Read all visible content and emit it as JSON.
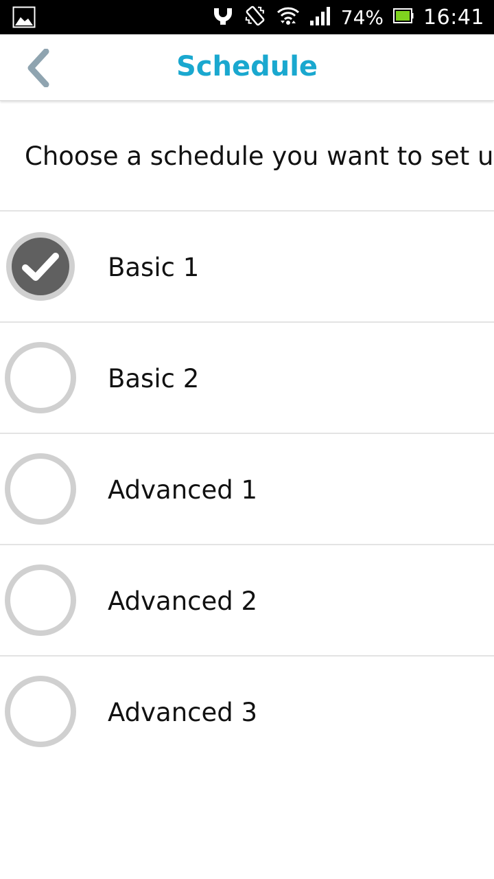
{
  "status_bar": {
    "battery_percent": "74%",
    "time": "16:41",
    "icons": [
      "gallery-notification-icon",
      "usb-icon",
      "vibrate-icon",
      "wifi-icon",
      "signal-icon",
      "battery-icon"
    ]
  },
  "header": {
    "title": "Schedule",
    "back_icon": "chevron-left-icon"
  },
  "prompt": "Choose a schedule you want to set up",
  "options": [
    {
      "label": "Basic 1",
      "selected": true
    },
    {
      "label": "Basic 2",
      "selected": false
    },
    {
      "label": "Advanced 1",
      "selected": false
    },
    {
      "label": "Advanced 2",
      "selected": false
    },
    {
      "label": "Advanced 3",
      "selected": false
    }
  ],
  "colors": {
    "accent": "#1aa8cf",
    "back_arrow": "#8fa4b0",
    "radio_ring": "#d0d0d0",
    "radio_selected_fill": "#606060"
  }
}
